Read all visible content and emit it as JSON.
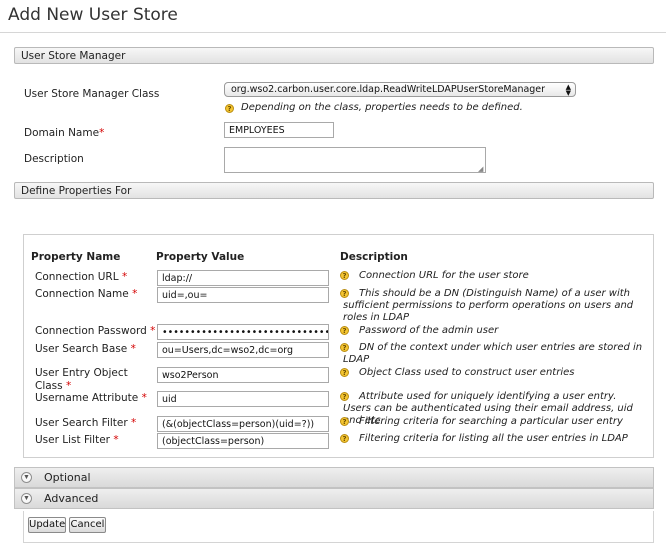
{
  "page": {
    "title": "Add New User Store"
  },
  "user_store_manager": {
    "section_title": "User Store Manager",
    "class_label": "User Store Manager Class",
    "class_selected": "org.wso2.carbon.user.core.ldap.ReadWriteLDAPUserStoreManager",
    "class_hint": "Depending on the class, properties needs to be defined.",
    "domain_label": "Domain Name",
    "domain_value": "EMPLOYEES",
    "description_label": "Description",
    "description_value": "",
    "required_marker": "*"
  },
  "properties": {
    "section_title": "Define Properties For",
    "headers": {
      "name": "Property Name",
      "value": "Property Value",
      "description": "Description"
    },
    "rows": [
      {
        "name": "Connection URL",
        "value": "ldap://",
        "description": "Connection URL for the user store"
      },
      {
        "name": "Connection Name",
        "value": "uid=,ou=",
        "description": "This should be a DN (Distinguish Name) of a user with sufficient permissions to perform operations on users and roles in LDAP"
      },
      {
        "name": "Connection Password",
        "value": "•••••••••••••••••••••••••••••••••••••••",
        "description": "Password of the admin user"
      },
      {
        "name": "User Search Base",
        "value": "ou=Users,dc=wso2,dc=org",
        "description": "DN of the context under which user entries are stored in LDAP"
      },
      {
        "name": "User Entry Object Class",
        "value": "wso2Person",
        "description": "Object Class used to construct user entries"
      },
      {
        "name": "Username Attribute",
        "value": "uid",
        "description": "Attribute used for uniquely identifying a user entry. Users can be authenticated using their email address, uid and etc"
      },
      {
        "name": "User Search Filter",
        "value": "(&(objectClass=person)(uid=?))",
        "description": "Filtering criteria for searching a particular user entry"
      },
      {
        "name": "User List Filter",
        "value": "(objectClass=person)",
        "description": "Filtering criteria for listing all the user entries in LDAP"
      }
    ]
  },
  "collapsibles": {
    "optional": "Optional",
    "advanced": "Advanced"
  },
  "buttons": {
    "update": "Update",
    "cancel": "Cancel"
  },
  "icons": {
    "help": "help-icon",
    "chevron": "chevron-down-icon"
  },
  "colors": {
    "help_icon": "#f4c531",
    "required": "#d40000"
  }
}
